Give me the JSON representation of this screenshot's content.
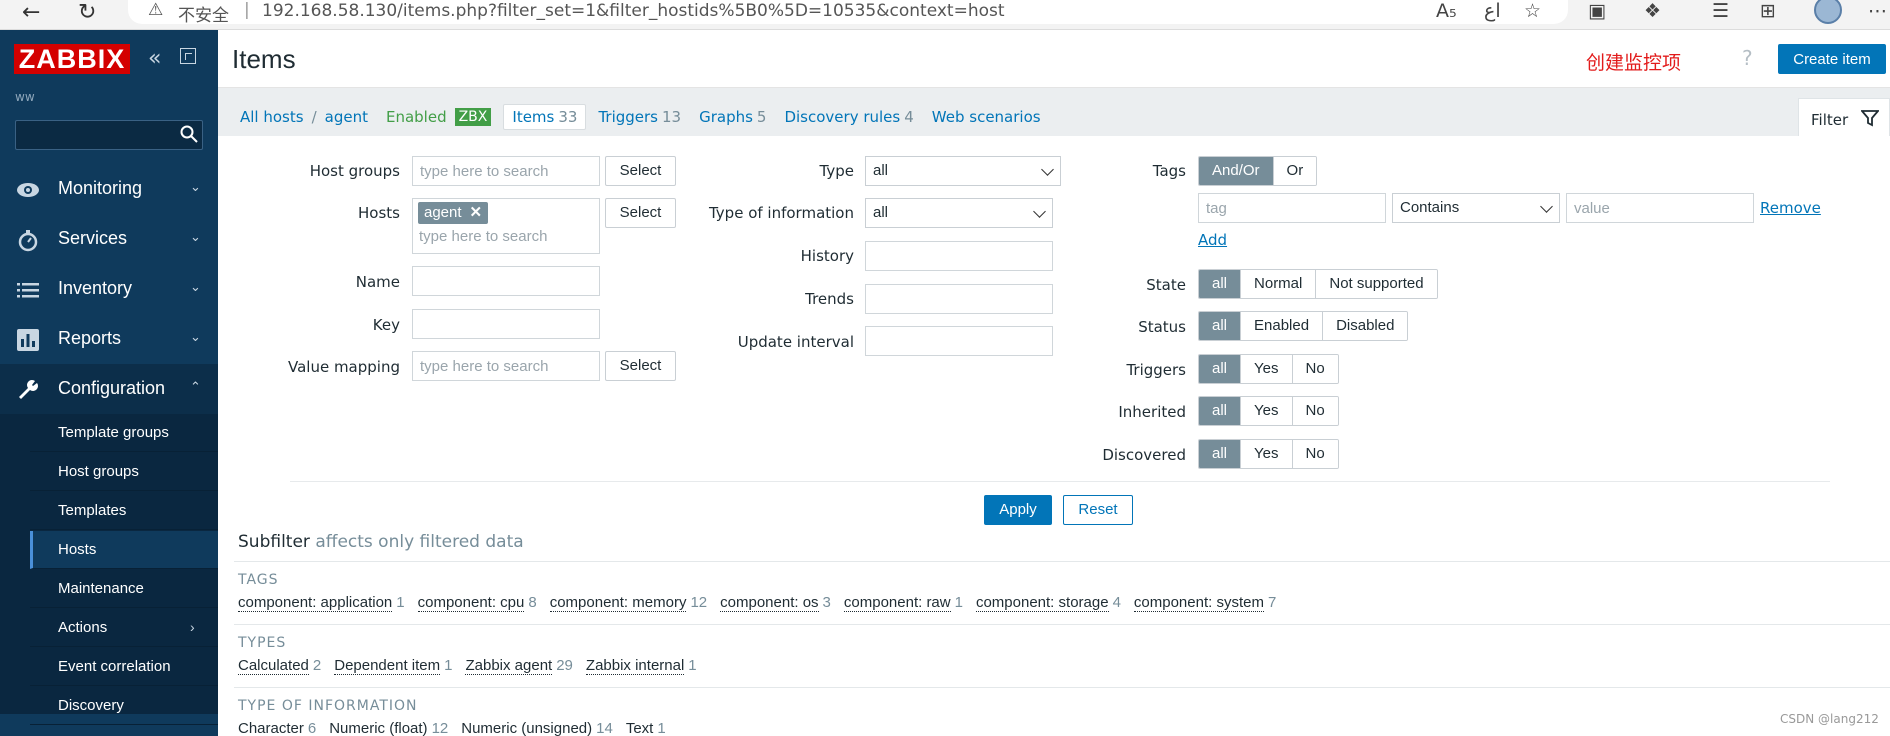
{
  "browser": {
    "security_label": "不安全",
    "separator": "|",
    "url": "192.168.58.130/items.php?filter_set=1&filter_hostids%5B0%5D=10535&context=host"
  },
  "sidebar": {
    "logo": "ZABBIX",
    "server_name": "ww",
    "menu": [
      {
        "label": "Monitoring",
        "icon": "eye-icon"
      },
      {
        "label": "Services",
        "icon": "stopwatch-icon"
      },
      {
        "label": "Inventory",
        "icon": "list-icon"
      },
      {
        "label": "Reports",
        "icon": "bar-chart-icon"
      },
      {
        "label": "Configuration",
        "icon": "wrench-icon"
      }
    ],
    "submenu": [
      {
        "label": "Template groups"
      },
      {
        "label": "Host groups"
      },
      {
        "label": "Templates"
      },
      {
        "label": "Hosts"
      },
      {
        "label": "Maintenance"
      },
      {
        "label": "Actions"
      },
      {
        "label": "Event correlation"
      },
      {
        "label": "Discovery"
      }
    ]
  },
  "header": {
    "title": "Items",
    "annotation": "创建监控项",
    "help": "?",
    "create_button": "Create item"
  },
  "breadcrumb": {
    "all_hosts": "All hosts",
    "separator": "/",
    "host": "agent",
    "status": "Enabled",
    "badge": "ZBX",
    "items_label": "Items",
    "items_count": "33",
    "triggers_label": "Triggers",
    "triggers_count": "13",
    "graphs_label": "Graphs",
    "graphs_count": "5",
    "discovery_label": "Discovery rules",
    "discovery_count": "4",
    "web_label": "Web scenarios",
    "filter_tab": "Filter"
  },
  "filter": {
    "host_groups_label": "Host groups",
    "host_groups_placeholder": "type here to search",
    "select": "Select",
    "hosts_label": "Hosts",
    "host_chip": "agent",
    "hosts_placeholder": "type here to search",
    "name_label": "Name",
    "key_label": "Key",
    "value_mapping_label": "Value mapping",
    "value_mapping_placeholder": "type here to search",
    "type_label": "Type",
    "type_value": "all",
    "type_info_label": "Type of information",
    "type_info_value": "all",
    "history_label": "History",
    "trends_label": "Trends",
    "update_interval_label": "Update interval",
    "tags_label": "Tags",
    "tags_andor": "And/Or",
    "tags_or": "Or",
    "tag_placeholder": "tag",
    "tag_operator": "Contains",
    "value_placeholder": "value",
    "remove": "Remove",
    "add": "Add",
    "state_label": "State",
    "state_options": [
      "all",
      "Normal",
      "Not supported"
    ],
    "status_label": "Status",
    "status_options": [
      "all",
      "Enabled",
      "Disabled"
    ],
    "triggers_label": "Triggers",
    "inherited_label": "Inherited",
    "discovered_label": "Discovered",
    "yesno_options": [
      "all",
      "Yes",
      "No"
    ],
    "apply": "Apply",
    "reset": "Reset"
  },
  "subfilter": {
    "title": "Subfilter",
    "subtitle": "affects only filtered data",
    "tags_title": "TAGS",
    "tags": [
      {
        "name": "component: application",
        "count": "1"
      },
      {
        "name": "component: cpu",
        "count": "8"
      },
      {
        "name": "component: memory",
        "count": "12"
      },
      {
        "name": "component: os",
        "count": "3"
      },
      {
        "name": "component: raw",
        "count": "1"
      },
      {
        "name": "component: storage",
        "count": "4"
      },
      {
        "name": "component: system",
        "count": "7"
      }
    ],
    "types_title": "TYPES",
    "types": [
      {
        "name": "Calculated",
        "count": "2"
      },
      {
        "name": "Dependent item",
        "count": "1"
      },
      {
        "name": "Zabbix agent",
        "count": "29"
      },
      {
        "name": "Zabbix internal",
        "count": "1"
      }
    ],
    "toi_title": "TYPE OF INFORMATION",
    "toi": [
      {
        "name": "Character",
        "count": "6"
      },
      {
        "name": "Numeric (float)",
        "count": "12"
      },
      {
        "name": "Numeric (unsigned)",
        "count": "14"
      },
      {
        "name": "Text",
        "count": "1"
      }
    ]
  },
  "watermark": "CSDN @lang212"
}
